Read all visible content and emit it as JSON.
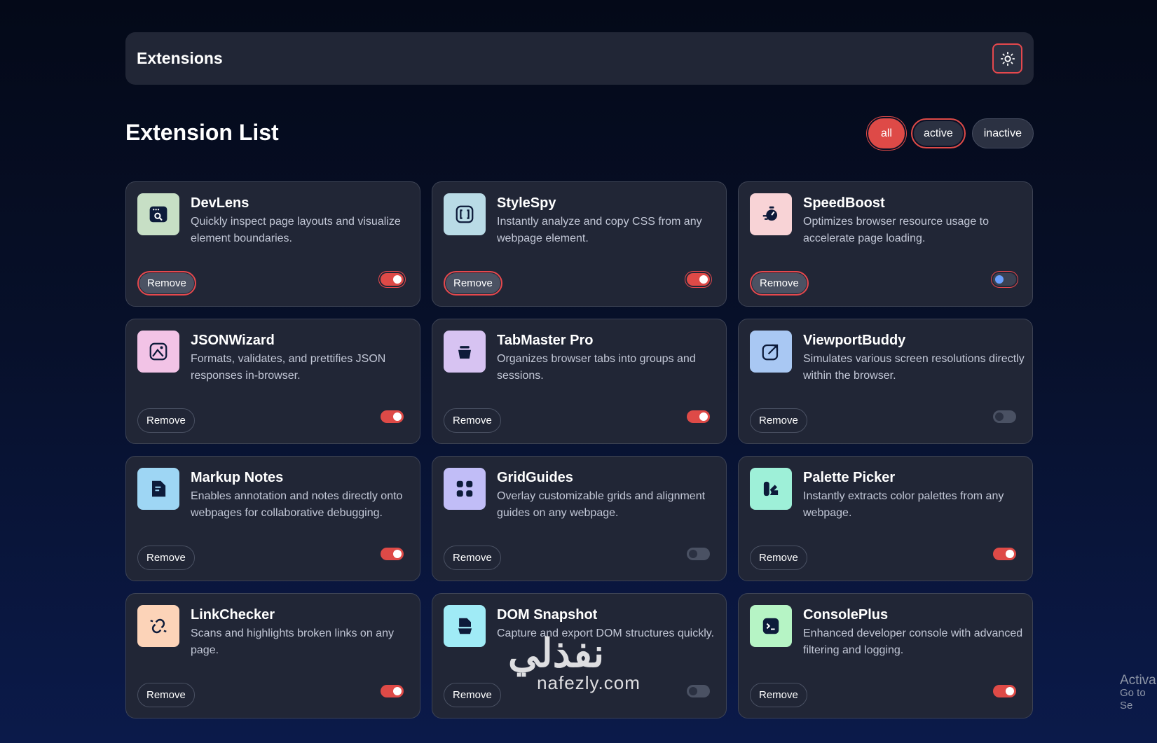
{
  "header": {
    "title": "Extensions",
    "theme_icon": "sun-icon"
  },
  "main": {
    "title": "Extension List",
    "filters": [
      {
        "label": "all",
        "state": "selected"
      },
      {
        "label": "active",
        "state": "focused"
      },
      {
        "label": "inactive",
        "state": "normal"
      }
    ]
  },
  "extensions": [
    {
      "name": "DevLens",
      "description": "Quickly inspect page layouts and visualize element boundaries.",
      "active": true,
      "icon": "devlens-icon",
      "icon_bg": "#c7dfc5",
      "remove_label": "Remove",
      "focused": true
    },
    {
      "name": "StyleSpy",
      "description": "Instantly analyze and copy CSS from any webpage element.",
      "active": true,
      "icon": "stylespy-icon",
      "icon_bg": "#b9dbe6",
      "remove_label": "Remove",
      "focused": true
    },
    {
      "name": "SpeedBoost",
      "description": "Optimizes browser resource usage to accelerate page loading.",
      "active": false,
      "icon": "speedboost-icon",
      "icon_bg": "#f8d3d6",
      "remove_label": "Remove",
      "focused": true
    },
    {
      "name": "JSONWizard",
      "description": "Formats, validates, and prettifies JSON responses in-browser.",
      "active": true,
      "icon": "jsonwizard-icon",
      "icon_bg": "#f2c3e6",
      "remove_label": "Remove",
      "focused": false
    },
    {
      "name": "TabMaster Pro",
      "description": "Organizes browser tabs into groups and sessions.",
      "active": true,
      "icon": "tabmaster-icon",
      "icon_bg": "#d7c3f2",
      "remove_label": "Remove",
      "focused": false
    },
    {
      "name": "ViewportBuddy",
      "description": "Simulates various screen resolutions directly within the browser.",
      "active": false,
      "icon": "viewportbuddy-icon",
      "icon_bg": "#a9c8f3",
      "remove_label": "Remove",
      "focused": false
    },
    {
      "name": "Markup Notes",
      "description": "Enables annotation and notes directly onto webpages for collaborative debugging.",
      "active": true,
      "icon": "markupnotes-icon",
      "icon_bg": "#9ed6f4",
      "remove_label": "Remove",
      "focused": false
    },
    {
      "name": "GridGuides",
      "description": "Overlay customizable grids and alignment guides on any webpage.",
      "active": false,
      "icon": "gridguides-icon",
      "icon_bg": "#c1bdf7",
      "remove_label": "Remove",
      "focused": false
    },
    {
      "name": "Palette Picker",
      "description": "Instantly extracts color palettes from any webpage.",
      "active": true,
      "icon": "palettepicker-icon",
      "icon_bg": "#9ef0d8",
      "remove_label": "Remove",
      "focused": false
    },
    {
      "name": "LinkChecker",
      "description": "Scans and highlights broken links on any page.",
      "active": true,
      "icon": "linkchecker-icon",
      "icon_bg": "#fcd3b8",
      "remove_label": "Remove",
      "focused": false
    },
    {
      "name": "DOM Snapshot",
      "description": "Capture and export DOM structures quickly.",
      "active": false,
      "icon": "domsnapshot-icon",
      "icon_bg": "#a0ebf6",
      "remove_label": "Remove",
      "focused": false
    },
    {
      "name": "ConsolePlus",
      "description": "Enhanced developer console with advanced filtering and logging.",
      "active": true,
      "icon": "consoleplus-icon",
      "icon_bg": "#b6f4c5",
      "remove_label": "Remove",
      "focused": false
    }
  ],
  "watermark": {
    "arabic": "نفذلي",
    "latin": "nafezly.com"
  },
  "os_overlay": {
    "line1": "Activa",
    "line2": "Go to Se"
  },
  "colors": {
    "accent": "#de4a47",
    "card_bg": "#212636",
    "toggle_off": "#4a5163"
  }
}
